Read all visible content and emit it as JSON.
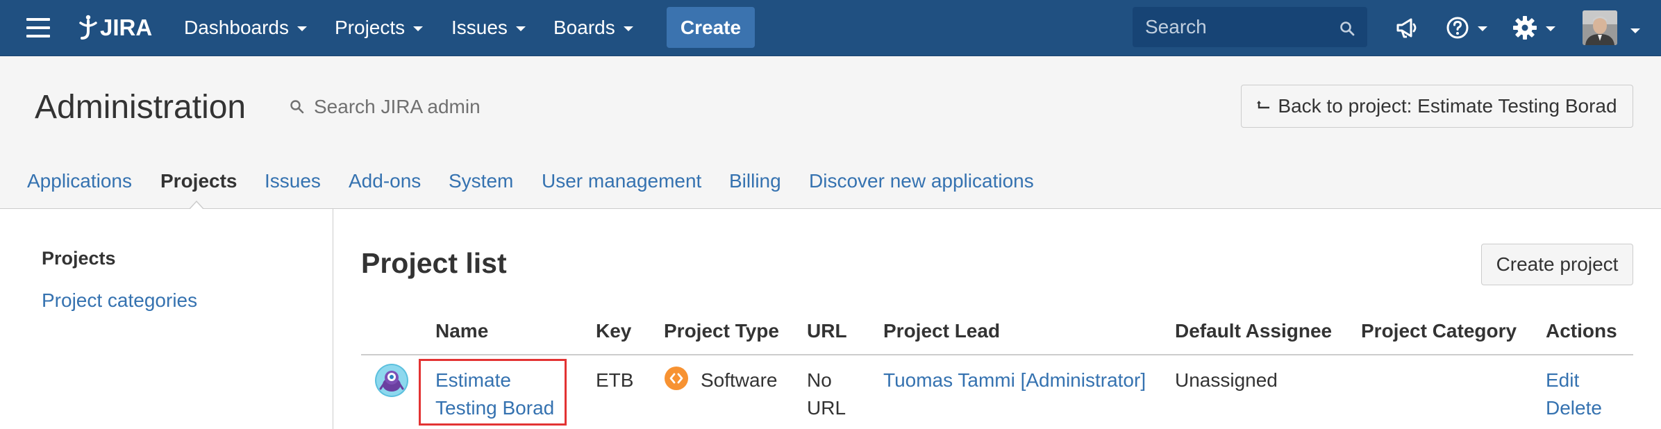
{
  "topnav": {
    "logo": "JIRA",
    "items": [
      {
        "label": "Dashboards"
      },
      {
        "label": "Projects"
      },
      {
        "label": "Issues"
      },
      {
        "label": "Boards"
      }
    ],
    "create_label": "Create",
    "search_placeholder": "Search",
    "icons": [
      "menu-icon",
      "megaphone-icon",
      "help-icon",
      "gear-icon",
      "avatar"
    ]
  },
  "admin": {
    "title": "Administration",
    "search_placeholder": "Search JIRA admin",
    "back_label": "Back to project: Estimate Testing Borad"
  },
  "tabs": [
    {
      "label": "Applications",
      "active": false
    },
    {
      "label": "Projects",
      "active": true
    },
    {
      "label": "Issues",
      "active": false
    },
    {
      "label": "Add-ons",
      "active": false
    },
    {
      "label": "System",
      "active": false
    },
    {
      "label": "User management",
      "active": false
    },
    {
      "label": "Billing",
      "active": false
    },
    {
      "label": "Discover new applications",
      "active": false
    }
  ],
  "sidebar": {
    "heading": "Projects",
    "link": "Project categories"
  },
  "main": {
    "title": "Project list",
    "create_project_label": "Create project",
    "columns": [
      "Name",
      "Key",
      "Project Type",
      "URL",
      "Project Lead",
      "Default Assignee",
      "Project Category",
      "Actions"
    ],
    "rows": [
      {
        "name_line1": "Estimate",
        "name_line2": "Testing Borad",
        "key": "ETB",
        "type": "Software",
        "url_line1": "No",
        "url_line2": "URL",
        "lead": "Tuomas Tammi [Administrator]",
        "assignee": "Unassigned",
        "category": "",
        "action_edit": "Edit",
        "action_delete": "Delete"
      }
    ]
  },
  "colors": {
    "header_bg": "#205081",
    "create_bg": "#3b73af",
    "link": "#3572b0",
    "highlight": "#e33333",
    "software_icon": "#f79232"
  }
}
